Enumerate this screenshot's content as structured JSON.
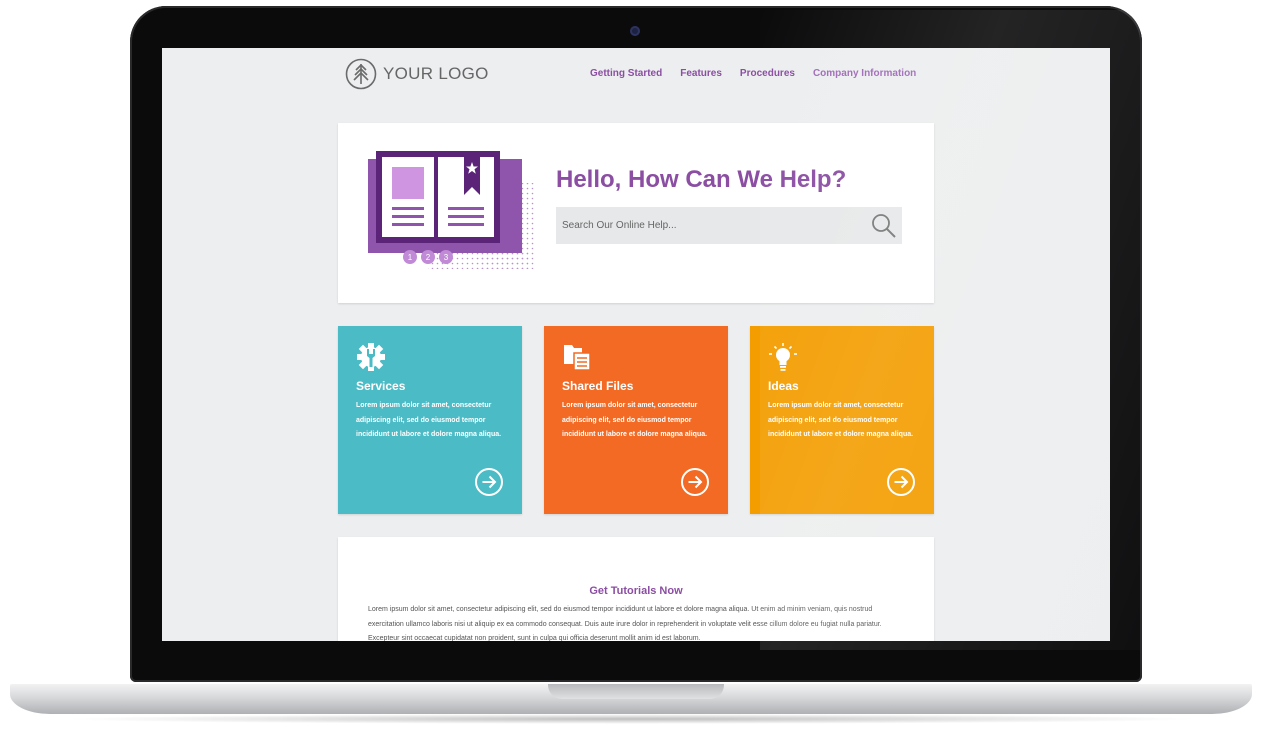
{
  "logo": {
    "text": "YOUR LOGO",
    "icon": "tree-icon"
  },
  "nav": {
    "items": [
      {
        "label": "Getting Started"
      },
      {
        "label": "Features"
      },
      {
        "label": "Procedures"
      },
      {
        "label": "Company Information"
      }
    ]
  },
  "hero": {
    "title": "Hello, How Can We Help?",
    "illustration_steps": [
      "1",
      "2",
      "3"
    ],
    "search": {
      "placeholder": "Search Our Online Help...",
      "value": "",
      "icon": "search-icon"
    }
  },
  "cards": [
    {
      "title": "Services",
      "text": "Lorem ipsum dolor sit amet, consectetur adipiscing elit, sed do eiusmod tempor incididunt ut labore et dolore magna aliqua.",
      "color": "#4bbbc6",
      "icon": "gear-wrench-icon"
    },
    {
      "title": "Shared Files",
      "text": "Lorem ipsum dolor sit amet, consectetur adipiscing elit, sed do eiusmod tempor incididunt ut labore et dolore magna aliqua.",
      "color": "#f26a23",
      "icon": "files-icon"
    },
    {
      "title": "Ideas",
      "text": "Lorem ipsum dolor sit amet, consectetur adipiscing elit, sed do eiusmod tempor incididunt ut labore et dolore magna aliqua.",
      "color": "#f39d00",
      "icon": "lightbulb-icon"
    }
  ],
  "tutorials": {
    "title": "Get Tutorials Now",
    "text": "Lorem ipsum dolor sit amet, consectetur adipiscing elit, sed do eiusmod tempor incididunt ut labore et dolore magna aliqua. Ut enim ad minim veniam, quis nostrud exercitation ullamco laboris nisi ut aliquip ex ea commodo consequat. Duis aute irure dolor in reprehenderit in voluptate velit esse cillum dolore eu fugiat nulla pariatur. Excepteur sint occaecat cupidatat non proident, sunt in culpa qui officia deserunt mollit anim id est laborum."
  },
  "colors": {
    "brand_purple": "#8b4ea3",
    "screen_bg": "#eceeef"
  }
}
